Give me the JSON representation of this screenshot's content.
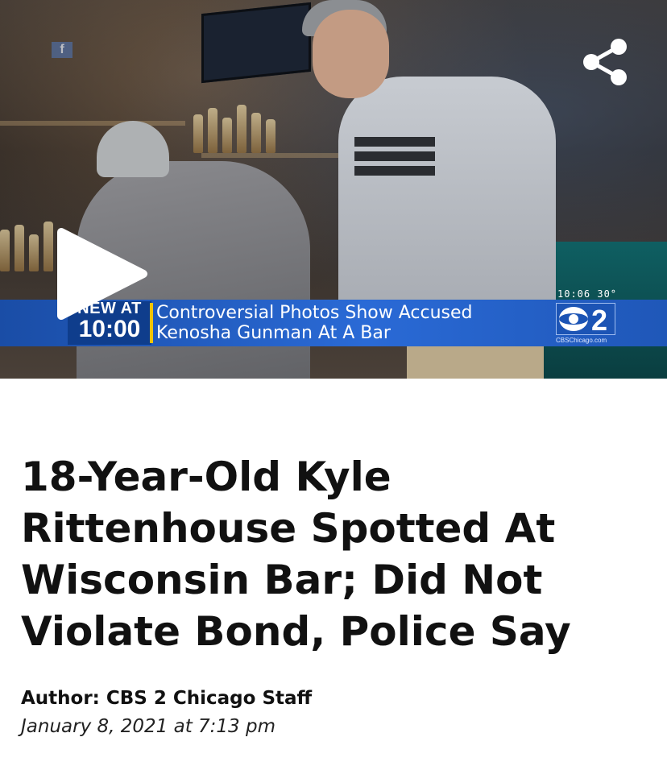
{
  "video": {
    "lower_third": {
      "new_at": "NEW AT",
      "time": "10:00",
      "headline_line1": "Controversial Photos Show Accused",
      "headline_line2": "Kenosha Gunman At A Bar",
      "clock": "10:06  30°",
      "channel_logo_text": "2",
      "channel_url": "CBSChicago.com"
    },
    "icons": {
      "share": "share-icon",
      "play": "play-icon",
      "facebook": "facebook-icon"
    },
    "colors": {
      "lower_third_blue": "#2a6ad6",
      "accent_yellow": "#f2c400"
    }
  },
  "article": {
    "title": "18-Year-Old Kyle Rittenhouse Spotted At Wisconsin Bar; Did Not Violate Bond, Police Say",
    "author": "Author: CBS 2 Chicago Staff",
    "date": "January 8, 2021 at 7:13 pm"
  }
}
